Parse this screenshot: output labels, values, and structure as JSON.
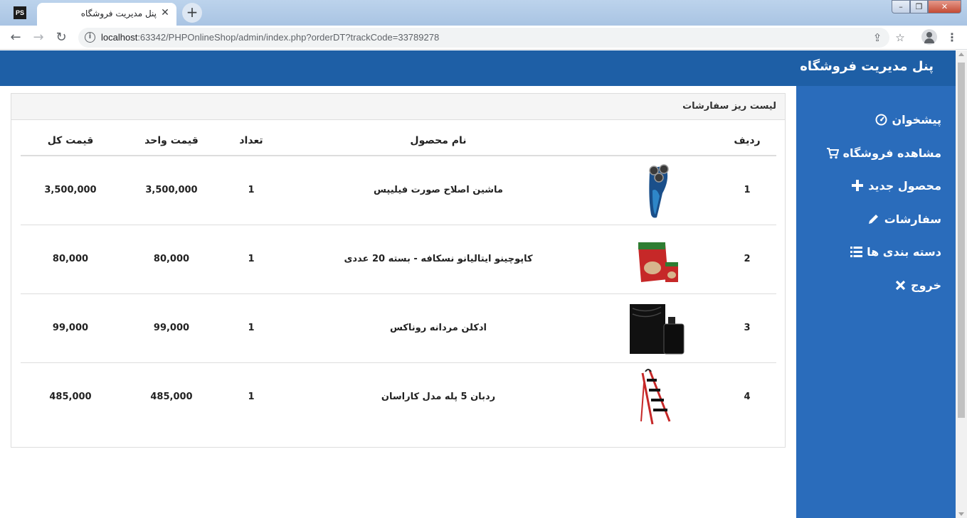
{
  "browser": {
    "app_icon": "PS",
    "tab_title": "پنل مدیریت فروشگاه",
    "url_host": "localhost",
    "url_rest": ":63342/PHPOnlineShop/admin/index.php?orderDT?trackCode=33789278"
  },
  "header": {
    "brand": "پنل مدیریت فروشگاه"
  },
  "sidebar": {
    "items": [
      {
        "label": "پیشخوان",
        "icon": "dashboard-icon"
      },
      {
        "label": "مشاهده فروشگاه",
        "icon": "cart-icon"
      },
      {
        "label": "محصول جدید",
        "icon": "plus-icon"
      },
      {
        "label": "سفارشات",
        "icon": "pencil-icon"
      },
      {
        "label": "دسته بندی ها",
        "icon": "list-icon"
      },
      {
        "label": "خروج",
        "icon": "close-icon"
      }
    ]
  },
  "panel": {
    "title": "لیست ریز سفارشات",
    "columns": {
      "index": "ردیف",
      "name": "نام محصول",
      "qty": "تعداد",
      "unit_price": "قیمت واحد",
      "total": "قیمت کل"
    },
    "rows": [
      {
        "index": "1",
        "name": "ماشین اصلاح صورت فیلیپس",
        "qty": "1",
        "unit_price": "3,500,000",
        "total": "3,500,000",
        "image": "shaver-image"
      },
      {
        "index": "2",
        "name": "کاپوچینو ایتالیانو نسکافه - بسته 20 عددی",
        "qty": "1",
        "unit_price": "80,000",
        "total": "80,000",
        "image": "cappuccino-image"
      },
      {
        "index": "3",
        "name": "ادکلن مردانه روناکس",
        "qty": "1",
        "unit_price": "99,000",
        "total": "99,000",
        "image": "perfume-image"
      },
      {
        "index": "4",
        "name": "ردبان 5 پله مدل کاراسان",
        "qty": "1",
        "unit_price": "485,000",
        "total": "485,000",
        "image": "ladder-image"
      }
    ]
  },
  "colors": {
    "header": "#1e5fa6",
    "sidebar": "#2a6cbb",
    "panel_head": "#f5f5f5"
  }
}
